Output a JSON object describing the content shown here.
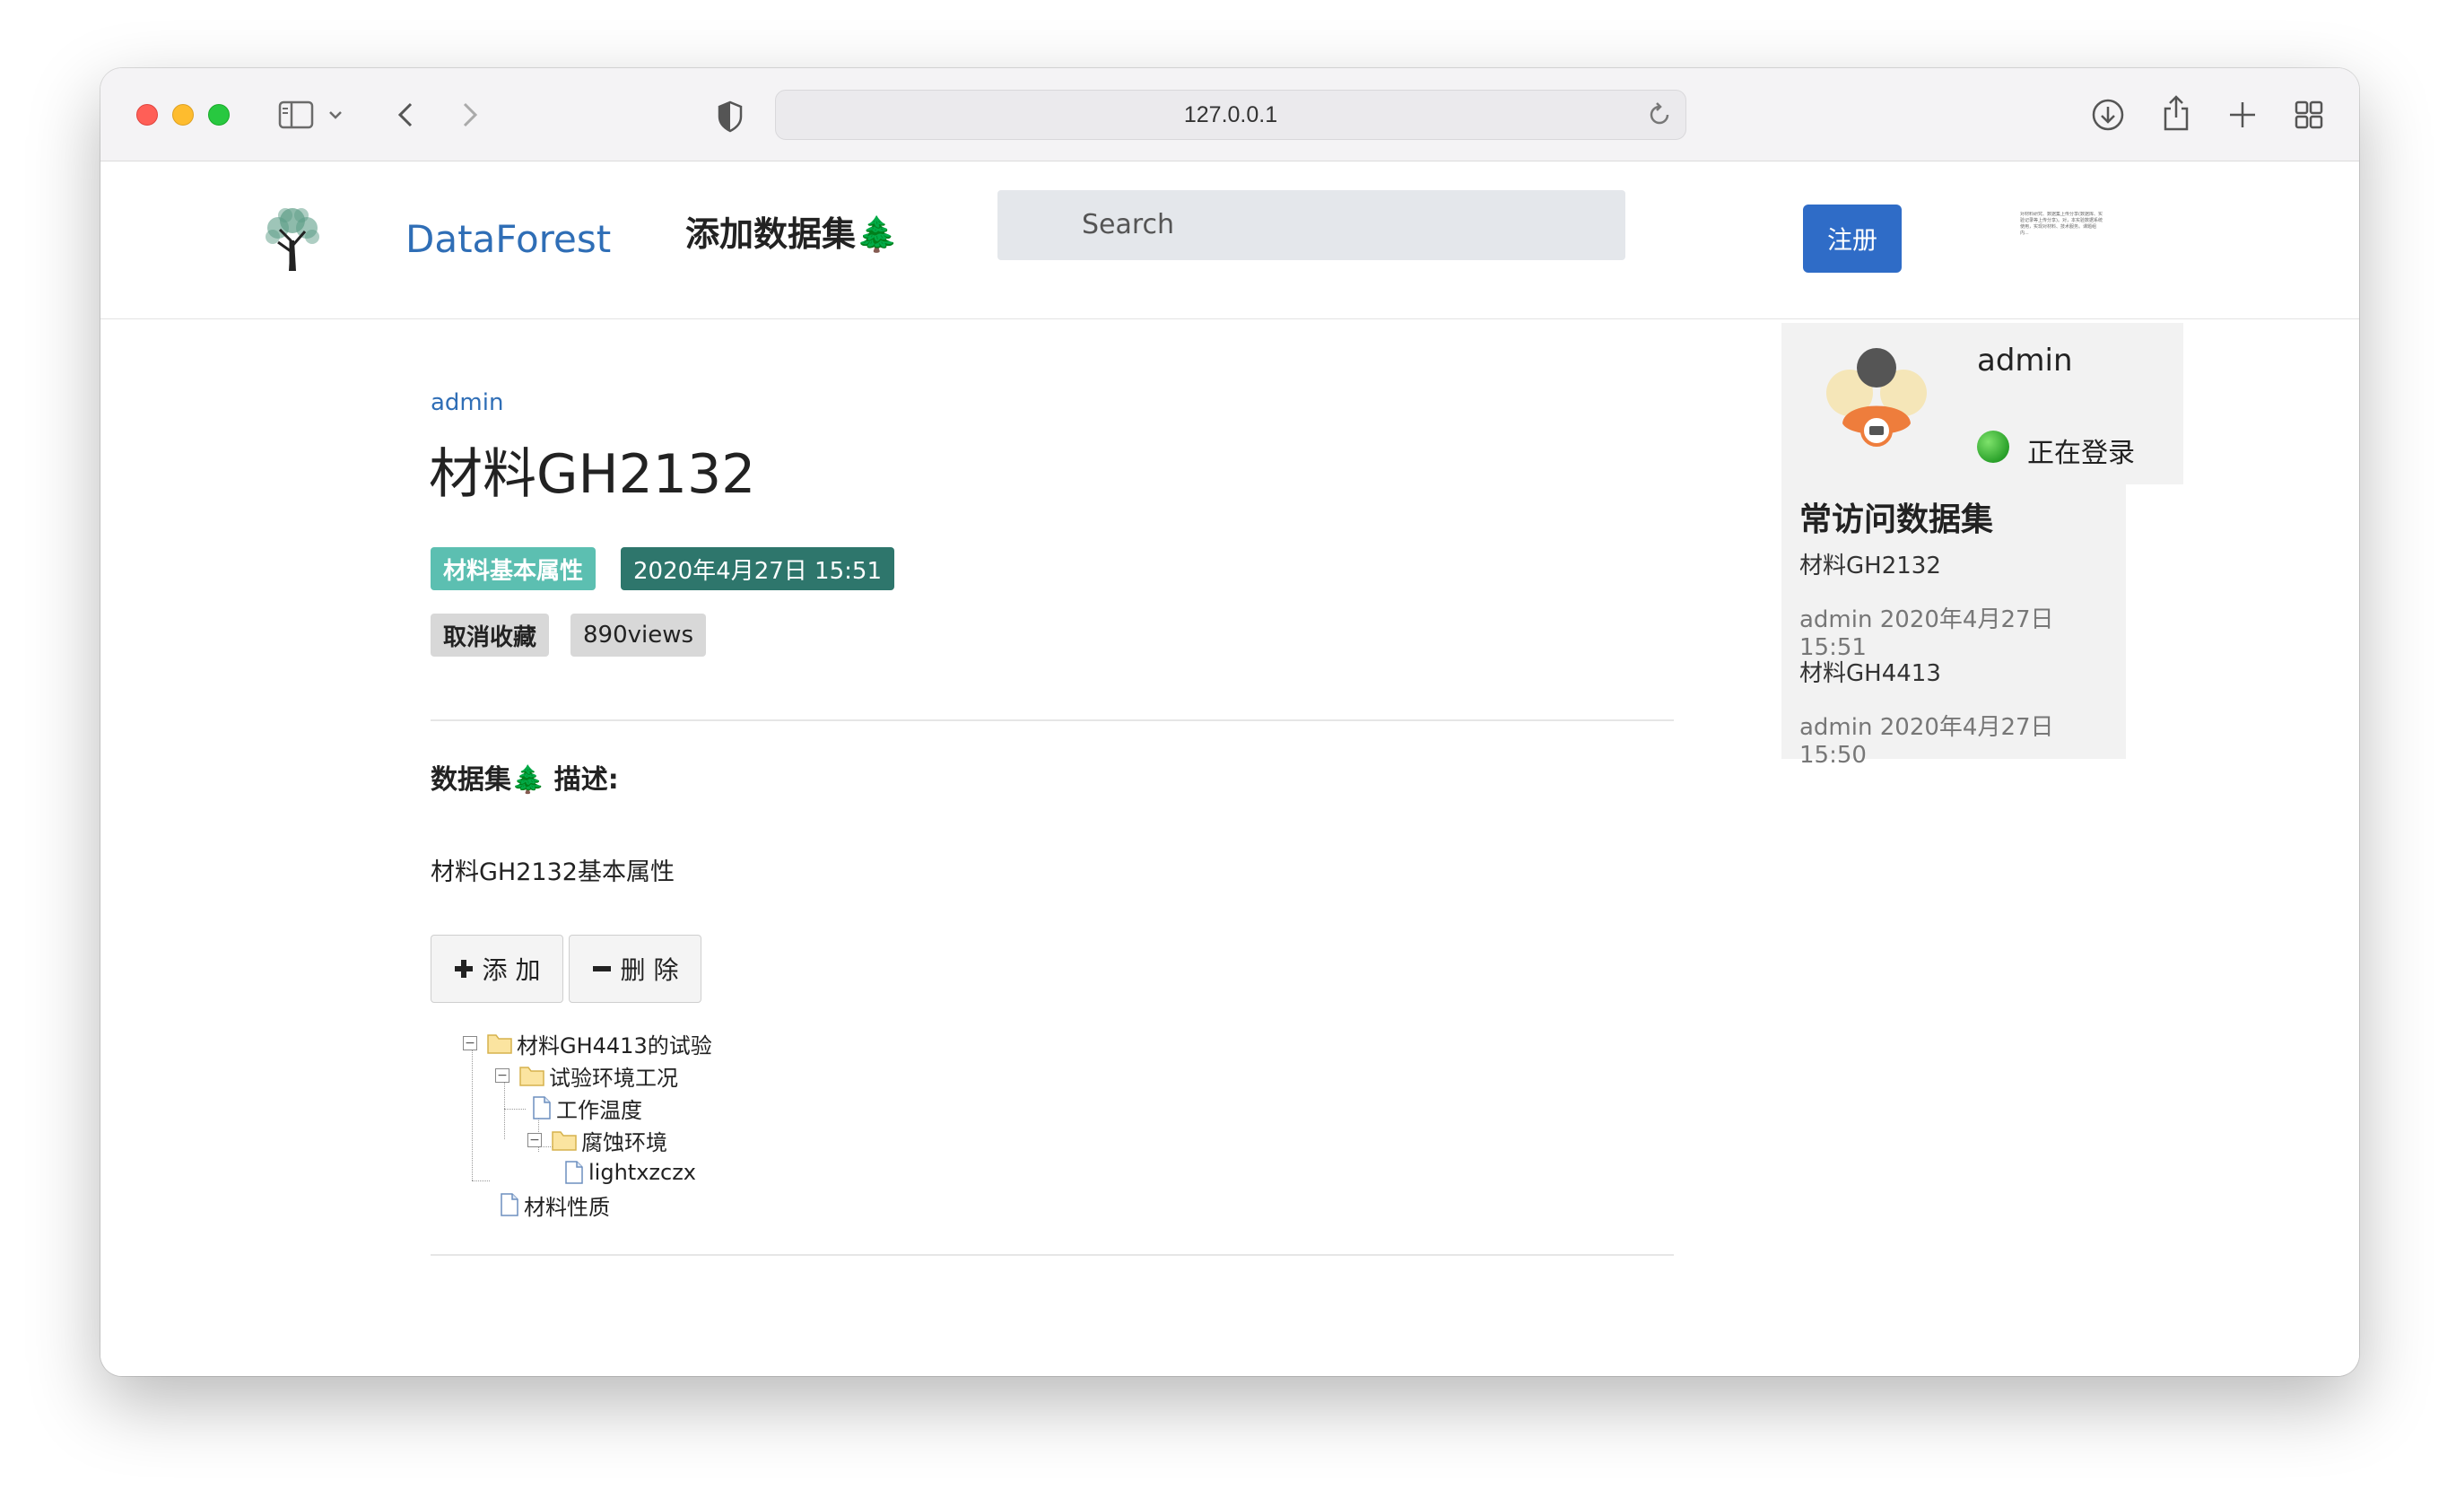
{
  "browser": {
    "address": "127.0.0.1"
  },
  "navbar": {
    "brand_name": "DataForest",
    "add_dataset": "添加数据集🌲",
    "search_placeholder": "Search",
    "register_label": "注册",
    "tiny_note": "对材料研究、数据集上传分享(数据库、实验记录等上传分享)。对，本实验数据系统使用，实现对材料、技术服务。课题组内..."
  },
  "dataset": {
    "author": "admin",
    "title": "材料GH2132",
    "category": "材料基本属性",
    "date": "2020年4月27日 15:51",
    "favorite_label": "取消收藏",
    "views": "890views",
    "desc_heading": "数据集🌲 描述:",
    "description": "材料GH2132基本属性",
    "add_label": "添 加",
    "delete_label": "删 除"
  },
  "tree": [
    {
      "label": "材料GH4413的试验",
      "type": "folder",
      "expanded": true
    },
    {
      "label": "试验环境工况",
      "type": "folder",
      "expanded": true
    },
    {
      "label": "工作温度",
      "type": "file"
    },
    {
      "label": "腐蚀环境",
      "type": "folder",
      "expanded": true
    },
    {
      "label": "lightxzczx",
      "type": "file"
    },
    {
      "label": "材料性质",
      "type": "file"
    }
  ],
  "user": {
    "name": "admin",
    "status": "正在登录",
    "status_color": "#2aa12a"
  },
  "frequent": {
    "title": "常访问数据集",
    "items": [
      {
        "name": "材料GH2132",
        "author": "admin",
        "date": "2020年4月27日 15:51"
      },
      {
        "name": "材料GH4413",
        "author": "admin",
        "date": "2020年4月27日 15:50"
      }
    ]
  }
}
